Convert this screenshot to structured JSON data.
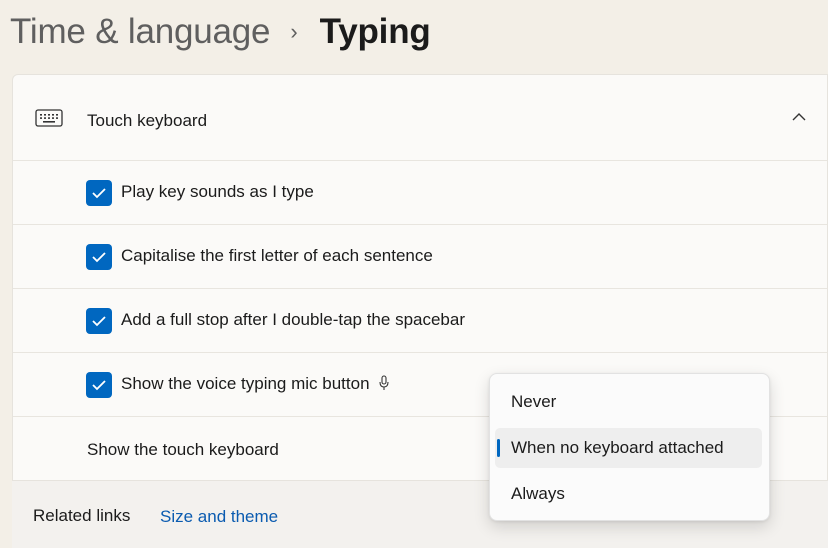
{
  "breadcrumb": {
    "parent": "Time & language",
    "separator": "›",
    "current": "Typing"
  },
  "section": {
    "title": "Touch keyboard",
    "icon": "keyboard-icon",
    "expanded": true
  },
  "options": [
    {
      "label": "Play key sounds as I type",
      "checked": true
    },
    {
      "label": "Capitalise the first letter of each sentence",
      "checked": true
    },
    {
      "label": "Add a full stop after I double-tap the spacebar",
      "checked": true
    },
    {
      "label": "Show the voice typing mic button",
      "checked": true,
      "icon": "mic-icon"
    }
  ],
  "show_touch_keyboard": {
    "label": "Show the touch keyboard",
    "selected": "When no keyboard attached",
    "menu_items": [
      "Never",
      "When no keyboard attached",
      "Always"
    ]
  },
  "related_links": {
    "label": "Related links",
    "link": "Size and theme"
  },
  "colors": {
    "accent": "#0067c0",
    "link": "#0a5bb0",
    "background": "#f3efe7",
    "card": "#fbfaf8"
  }
}
